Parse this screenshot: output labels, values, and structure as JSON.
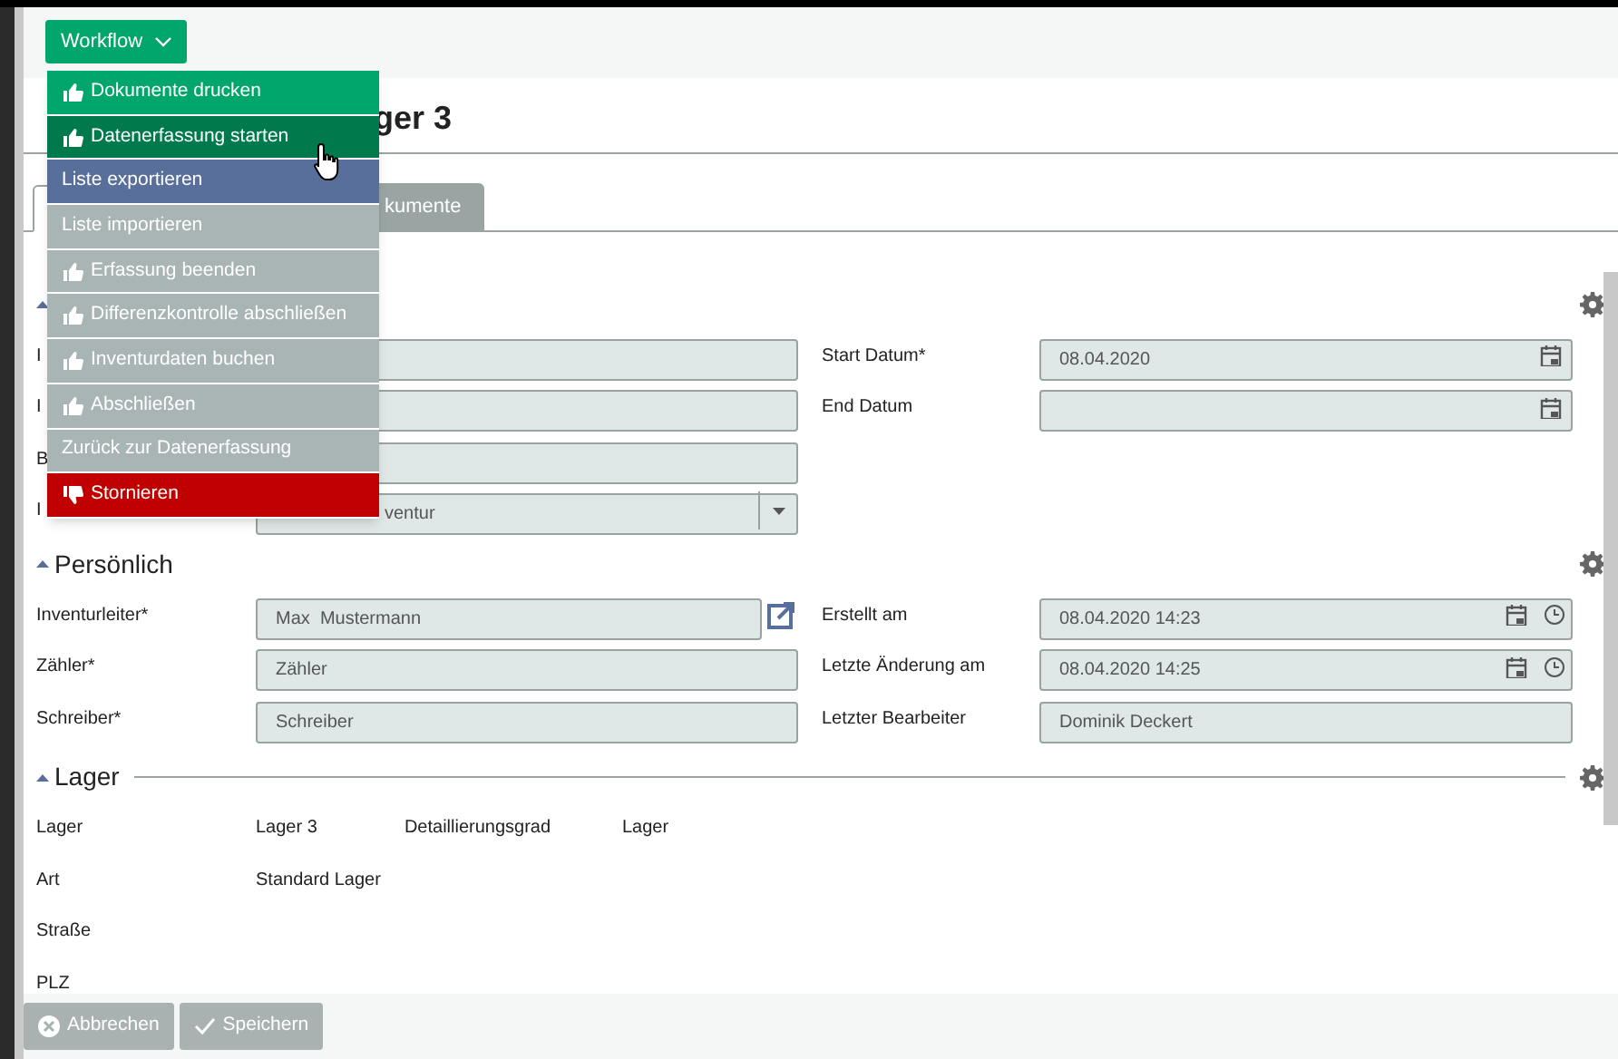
{
  "toolbar": {
    "workflow_button": "Workflow"
  },
  "workflow_menu": [
    {
      "label": "Dokumente drucken",
      "kind": "approve",
      "disabled": false,
      "hovered": false
    },
    {
      "label": "Datenerfassung starten",
      "kind": "approve",
      "disabled": false,
      "hovered": true
    },
    {
      "label": "Liste exportieren",
      "kind": "neutral",
      "disabled": false,
      "hovered": false
    },
    {
      "label": "Liste importieren",
      "kind": "neutral",
      "disabled": true,
      "hovered": false
    },
    {
      "label": "Erfassung beenden",
      "kind": "approve",
      "disabled": true,
      "hovered": false
    },
    {
      "label": "Differenzkontrolle abschließen",
      "kind": "approve",
      "disabled": true,
      "hovered": false
    },
    {
      "label": "Inventurdaten buchen",
      "kind": "approve",
      "disabled": true,
      "hovered": false
    },
    {
      "label": "Abschließen",
      "kind": "approve",
      "disabled": true,
      "hovered": false
    },
    {
      "label": "Zurück zur Datenerfassung",
      "kind": "neutral",
      "disabled": true,
      "hovered": false
    },
    {
      "label": "Stornieren",
      "kind": "reject",
      "disabled": false,
      "hovered": false
    }
  ],
  "page_title": "ger 3",
  "tabs": [
    {
      "selected": true
    },
    {
      "label": "kumente",
      "selected": false
    }
  ],
  "sections": [
    {
      "expanded": true,
      "rule": false,
      "left": [
        {
          "label": "I",
          "kind": "text"
        },
        {
          "label": "I",
          "kind": "text"
        },
        {
          "label": "B",
          "kind": "text"
        },
        {
          "label": "I",
          "kind": "select",
          "value": "ventur"
        }
      ],
      "right": [
        {
          "label": "Start Datum*",
          "kind": "date",
          "value": "08.04.2020"
        },
        {
          "label": "End Datum",
          "kind": "date"
        }
      ]
    },
    {
      "title": "Persönlich",
      "expanded": true,
      "rule": false,
      "left": [
        {
          "label": "Inventurleiter*",
          "kind": "link",
          "value": "Max  Mustermann"
        },
        {
          "label": "Zähler*",
          "kind": "text",
          "placeholder": "Zähler"
        },
        {
          "label": "Schreiber*",
          "kind": "text",
          "placeholder": "Schreiber"
        }
      ],
      "right": [
        {
          "label": "Erstellt am",
          "kind": "datetime",
          "value": "08.04.2020 14:23"
        },
        {
          "label": "Letzte Änderung am",
          "kind": "datetime",
          "value": "08.04.2020 14:25"
        },
        {
          "label": "Letzter Bearbeiter",
          "kind": "text",
          "value": "Dominik Deckert"
        }
      ]
    },
    {
      "title": "Lager",
      "expanded": true,
      "rule": true,
      "left": [
        {
          "label": "Lager",
          "kind": "static",
          "value": "Lager 3"
        },
        {
          "label": "Art",
          "kind": "static",
          "value": "Standard Lager"
        },
        {
          "label": "Straße",
          "kind": "static"
        },
        {
          "label": "PLZ",
          "kind": "static"
        }
      ],
      "right": [
        {
          "label": "Detaillierungsgrad",
          "kind": "static",
          "value": "Lager"
        }
      ]
    }
  ],
  "footer": [
    {
      "label": "Abbrechen",
      "kind": "cancel",
      "disabled": true
    },
    {
      "label": "Speichern",
      "kind": "save",
      "disabled": true
    }
  ]
}
